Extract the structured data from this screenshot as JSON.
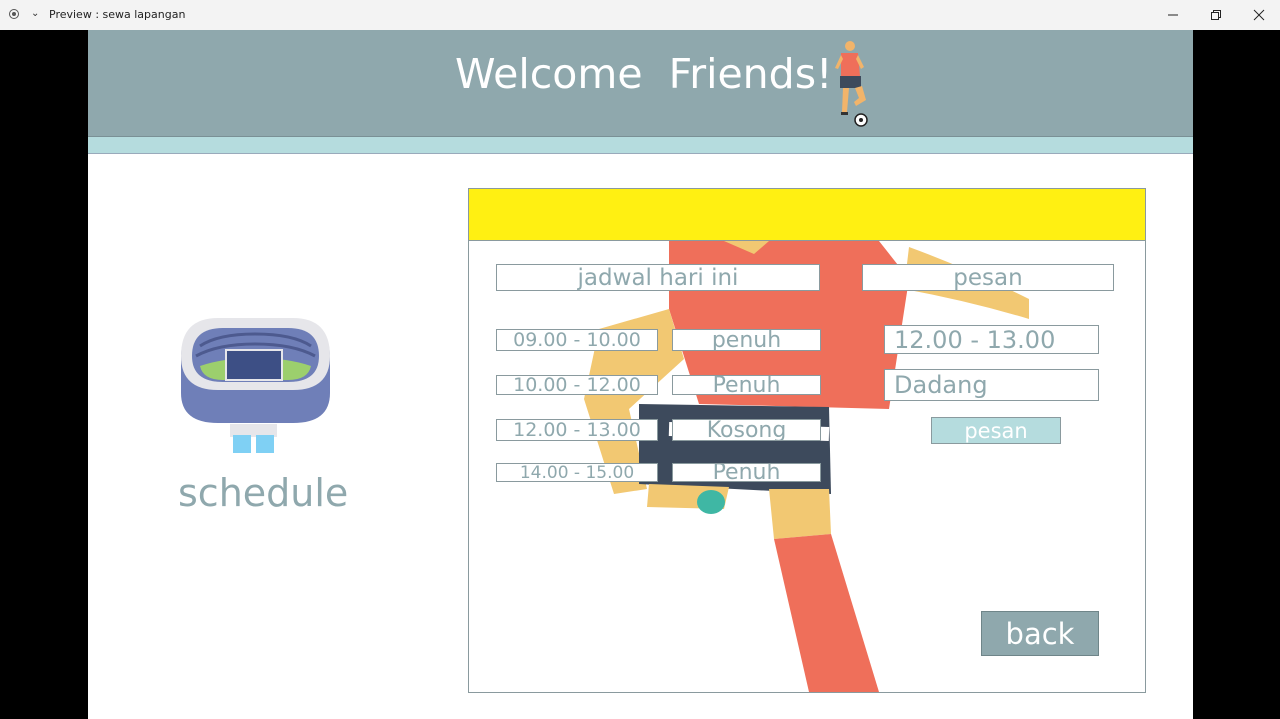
{
  "window": {
    "title": "Preview : sewa lapangan",
    "icons": [
      "record-icon",
      "chevron-down-icon",
      "minimize-icon",
      "maximize-icon",
      "close-icon"
    ]
  },
  "header": {
    "title": "Welcome  Friends!"
  },
  "sidebar": {
    "label": "schedule"
  },
  "panel": {
    "schedule_header": "jadwal hari ini",
    "order_header": "pesan",
    "slots": [
      {
        "time": "09.00 - 10.00",
        "status": "penuh"
      },
      {
        "time": "10.00 - 12.00",
        "status": "Penuh"
      },
      {
        "time": "12.00 - 13.00",
        "status": "Kosong"
      },
      {
        "time": "14.00 - 15.00",
        "status": "Penuh"
      }
    ],
    "order_time_value": "12.00 - 13.00",
    "order_name_value": "Dadang",
    "order_button": "pesan",
    "back_button": "back"
  },
  "colors": {
    "header_bg": "#8fa8ad",
    "subbar": "#b5dcde",
    "panel_top": "#fff012",
    "text": "#8fa8ad",
    "button_light": "#b5dcde"
  }
}
